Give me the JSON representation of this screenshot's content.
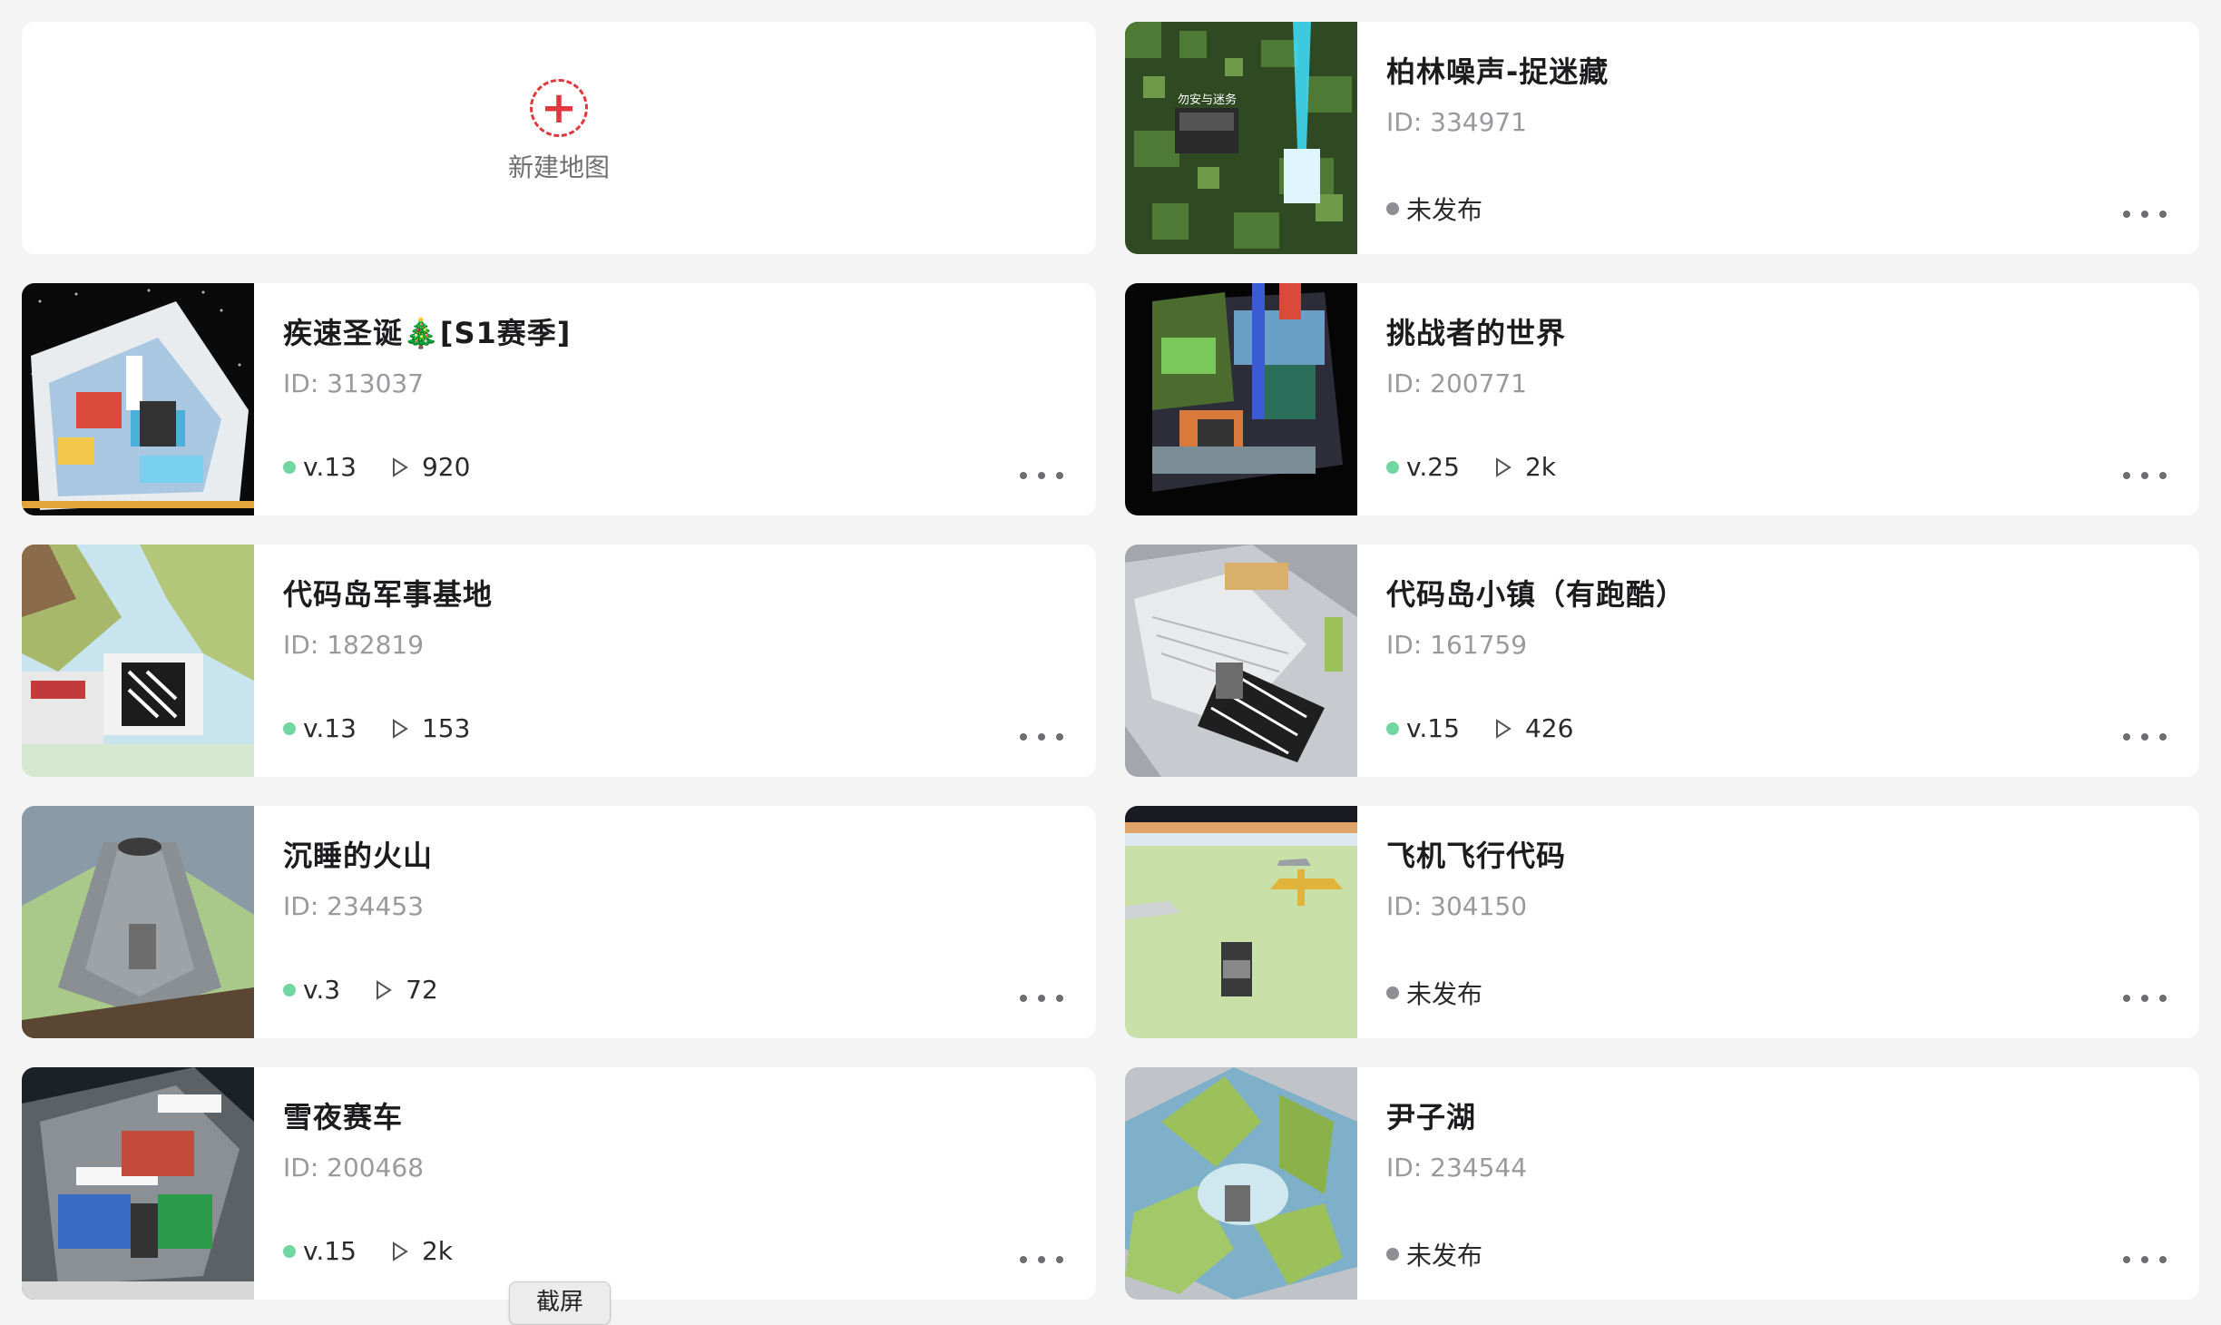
{
  "new_map": {
    "label": "新建地图",
    "icon": "plus-circle-icon",
    "accent": "#e0383e"
  },
  "status_colors": {
    "published": "#72d6a0",
    "unpublished": "#8e8e93"
  },
  "maps": [
    {
      "title": "柏林噪声-捉迷藏",
      "id": "ID: 334971",
      "published": false,
      "status": "未发布",
      "thumb_text": "勿安与迷务"
    },
    {
      "title": "疾速圣诞🎄[S1赛季]",
      "id": "ID: 313037",
      "published": true,
      "version": "v.13",
      "plays": "920"
    },
    {
      "title": "挑战者的世界",
      "id": "ID: 200771",
      "published": true,
      "version": "v.25",
      "plays": "2k"
    },
    {
      "title": "代码岛军事基地",
      "id": "ID: 182819",
      "published": true,
      "version": "v.13",
      "plays": "153"
    },
    {
      "title": "代码岛小镇（有跑酷）",
      "id": "ID: 161759",
      "published": true,
      "version": "v.15",
      "plays": "426"
    },
    {
      "title": "沉睡的火山",
      "id": "ID: 234453",
      "published": true,
      "version": "v.3",
      "plays": "72"
    },
    {
      "title": "飞机飞行代码",
      "id": "ID: 304150",
      "published": false,
      "status": "未发布"
    },
    {
      "title": "雪夜赛车",
      "id": "ID: 200468",
      "published": true,
      "version": "v.15",
      "plays": "2k"
    },
    {
      "title": "尹子湖",
      "id": "ID: 234544",
      "published": false,
      "status": "未发布"
    }
  ],
  "tooltip": "截屏"
}
